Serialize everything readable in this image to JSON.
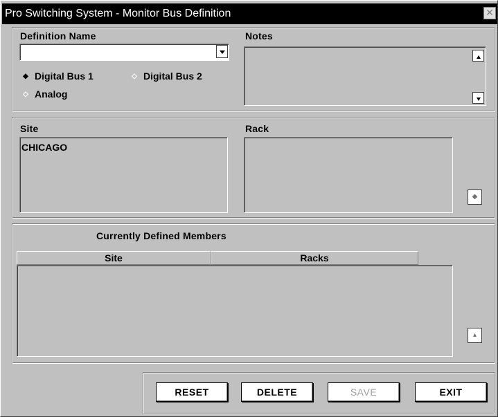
{
  "window": {
    "title": "Pro Switching System - Monitor Bus Definition",
    "close_glyph": "✕"
  },
  "definition": {
    "name_label": "Definition Name",
    "name_value": "",
    "notes_label": "Notes",
    "notes_value": "",
    "radios": [
      {
        "label": "Digital Bus 1",
        "selected": true
      },
      {
        "label": "Digital Bus 2",
        "selected": false
      },
      {
        "label": "Analog",
        "selected": false
      }
    ]
  },
  "selection": {
    "site_label": "Site",
    "site_items": [
      "CHICAGO"
    ],
    "rack_label": "Rack",
    "rack_items": []
  },
  "members": {
    "title": "Currently Defined Members",
    "columns": [
      "Site",
      "Racks"
    ],
    "rows": []
  },
  "buttons": {
    "reset": "RESET",
    "delete": "DELETE",
    "save": "SAVE",
    "exit": "EXIT"
  },
  "icons": {
    "combo_arrow": "chevron-down-icon",
    "scroll_up": "arrow-up-icon",
    "scroll_down": "arrow-down-icon"
  }
}
